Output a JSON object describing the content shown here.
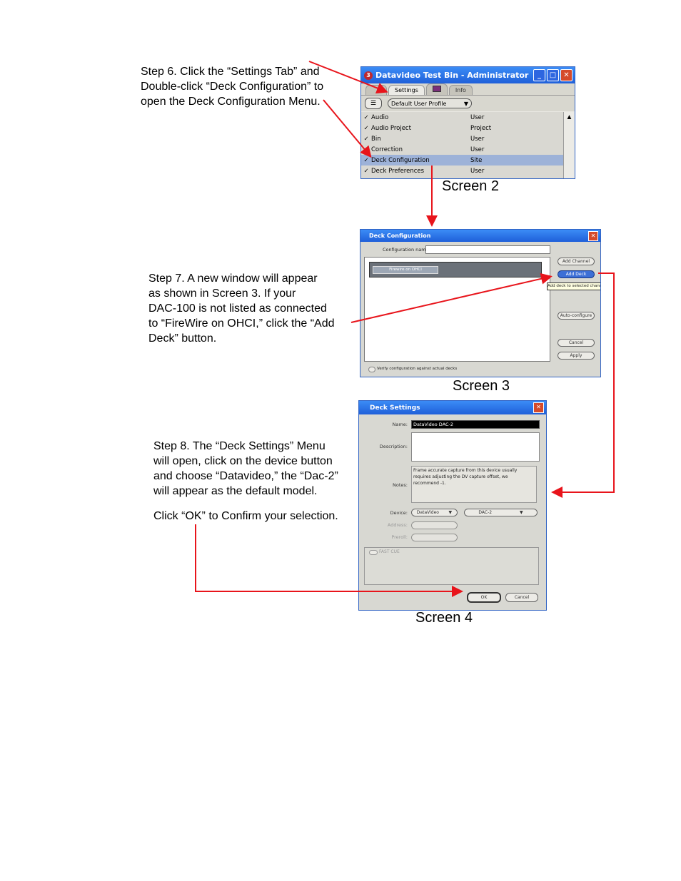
{
  "steps": {
    "step6": "Step 6.  Click the “Settings Tab” and\nDouble-click “Deck Configuration” to\nopen the Deck Configuration Menu.",
    "step7": "Step 7.  A new window will appear\nas shown in Screen 3.  If your\nDAC-100 is not listed as connected\nto “FireWire on OHCI,” click the “Add\nDeck” button.",
    "step8": "Step 8.  The “Deck Settings” Menu\nwill open, click on the device button\nand choose “Datavideo,” the “Dac-2”\nwill appear as the default model.",
    "step8_confirm": "Click “OK” to Confirm your selection."
  },
  "captions": {
    "screen2": "Screen 2",
    "screen3": "Screen 3",
    "screen4": "Screen 4"
  },
  "screen2": {
    "title": "Datavideo Test Bin - Administrator",
    "tabs": [
      "Settings",
      "Info"
    ],
    "profile": "Default User Profile",
    "rows": [
      {
        "check": "✓",
        "name": "Audio",
        "scope": "User"
      },
      {
        "check": "✓",
        "name": "Audio Project",
        "scope": "Project"
      },
      {
        "check": "✓",
        "name": "Bin",
        "scope": "User"
      },
      {
        "check": "✓",
        "name": "Correction",
        "scope": "User"
      },
      {
        "check": "✓",
        "name": "Deck Configuration",
        "scope": "Site"
      },
      {
        "check": "✓",
        "name": "Deck Preferences",
        "scope": "User"
      }
    ]
  },
  "screen3": {
    "title": "Deck Configuration",
    "config_label": "Configuration name:",
    "channel": "Firewire on OHCI",
    "buttons": {
      "add_channel": "Add Channel",
      "add_deck": "Add Deck",
      "auto_configure": "Auto-configure",
      "cancel": "Cancel",
      "apply": "Apply"
    },
    "tooltip": "Add deck to selected channel",
    "verify": "Verify configuration against actual decks"
  },
  "screen4": {
    "title": "Deck Settings",
    "name_label": "Name:",
    "name_value": "DataVideo DAC-2",
    "description_label": "Description:",
    "notes_label": "Notes:",
    "notes_text": "Frame accurate capture from this device usually requires adjusting the DV capture offset, we recommend -1.",
    "device_label": "Device:",
    "device_value": "DataVideo",
    "model_value": "DAC-2",
    "address_label": "Address:",
    "preroll_label": "Preroll:",
    "fast_cue": "FAST CUE",
    "ok": "OK",
    "cancel": "Cancel"
  },
  "colors": {
    "arrow": "#e8141b",
    "xp_blue": "#2b6be8",
    "selection": "#9db2d8"
  }
}
